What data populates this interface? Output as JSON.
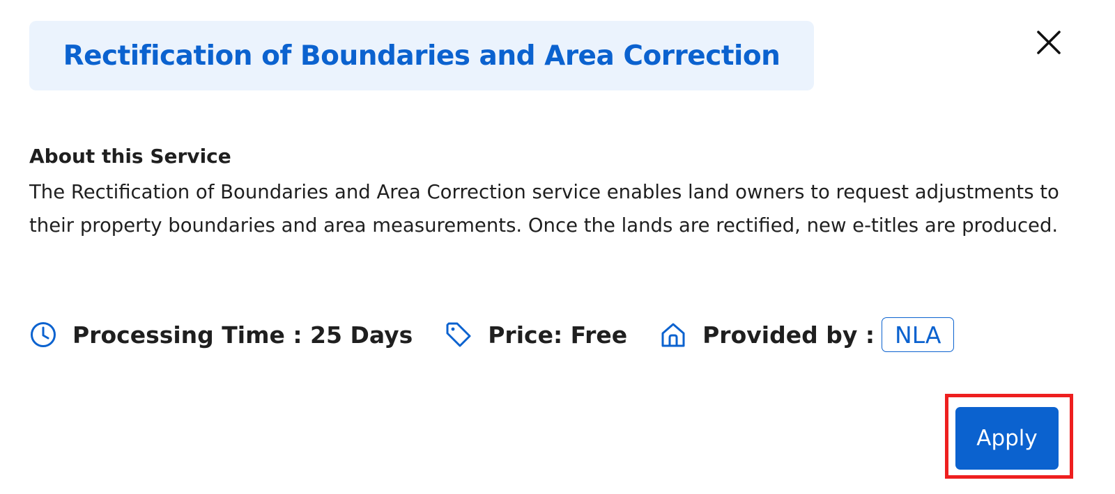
{
  "dialog": {
    "title": "Rectification of Boundaries and Area Correction",
    "close_icon": "close-icon"
  },
  "about": {
    "heading": "About this Service",
    "description": "The Rectification of Boundaries and Area Correction service enables land owners to request adjustments to their property boundaries and area measurements. Once the lands are rectified, new e-titles are produced."
  },
  "meta": {
    "processing_time_label": "Processing Time : 25 Days",
    "processing_time_icon": "clock-icon",
    "price_label": "Price: Free",
    "price_icon": "tag-icon",
    "provider_label": "Provided by :",
    "provider_icon": "home-icon",
    "provider_name": "NLA"
  },
  "actions": {
    "apply_label": "Apply"
  },
  "colors": {
    "accent": "#0b62cf",
    "title_background": "#ebf3fd",
    "highlight": "#ee1f1f",
    "text": "#1f1f1f"
  }
}
